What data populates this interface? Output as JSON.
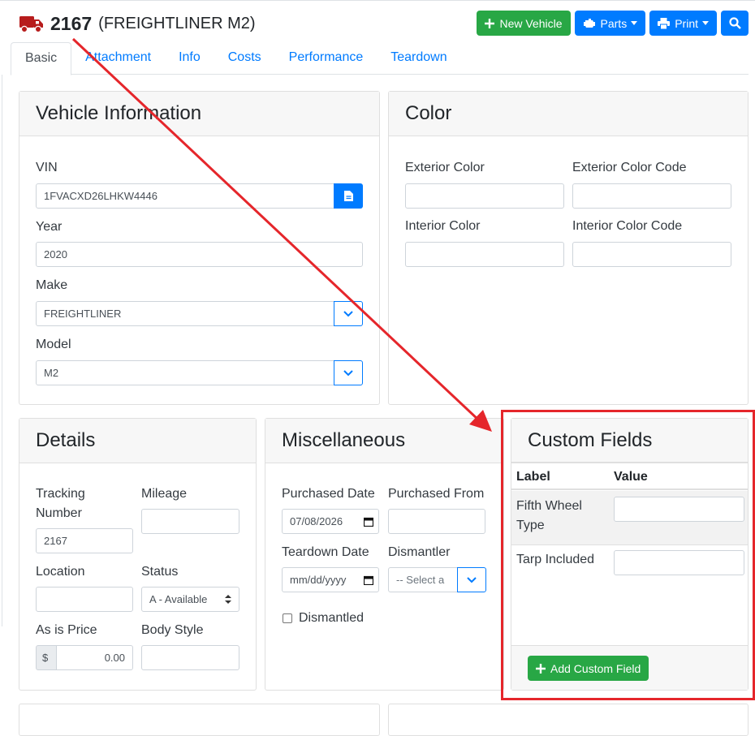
{
  "header": {
    "vehicle_number": "2167",
    "vehicle_description": "(FREIGHTLINER M2)"
  },
  "toolbar": {
    "new_vehicle": "New Vehicle",
    "parts": "Parts",
    "print": "Print"
  },
  "tabs": [
    "Basic",
    "Attachment",
    "Info",
    "Costs",
    "Performance",
    "Teardown"
  ],
  "vehicle_info": {
    "title": "Vehicle Information",
    "vin_label": "VIN",
    "vin_value": "1FVACXD26LHKW4446",
    "year_label": "Year",
    "year_value": "2020",
    "make_label": "Make",
    "make_value": "FREIGHTLINER",
    "model_label": "Model",
    "model_value": "M2"
  },
  "color": {
    "title": "Color",
    "exterior_color": "Exterior Color",
    "exterior_color_code": "Exterior Color Code",
    "interior_color": "Interior Color",
    "interior_color_code": "Interior Color Code"
  },
  "details": {
    "title": "Details",
    "tracking_label_1": "Tracking",
    "tracking_label_2": "Number",
    "tracking_value": "2167",
    "mileage_label": "Mileage",
    "location_label": "Location",
    "status_label": "Status",
    "status_value": "A - Available",
    "price_label": "As is Price",
    "price_prefix": "$",
    "price_value": "0.00",
    "body_style_label": "Body Style"
  },
  "misc": {
    "title": "Miscellaneous",
    "purchased_date_label": "Purchased Date",
    "purchased_date_value": "07/08/2026",
    "purchased_from_label": "Purchased From",
    "teardown_date_label": "Teardown Date",
    "teardown_date_placeholder": "mm/dd/yyyy",
    "dismantler_label": "Dismantler",
    "dismantler_value": "-- Select a",
    "dismantled_label": "Dismantled"
  },
  "custom_fields": {
    "title": "Custom Fields",
    "col_label": "Label",
    "col_value": "Value",
    "row1_label_1": "Fifth Wheel",
    "row1_label_2": "Type",
    "row2_label": "Tarp Included",
    "add_button": "Add Custom Field"
  },
  "colors": {
    "accent_blue": "#007bff",
    "green": "#28a745",
    "truck_red": "#b71c1c",
    "annotation_red": "#e5262b"
  }
}
